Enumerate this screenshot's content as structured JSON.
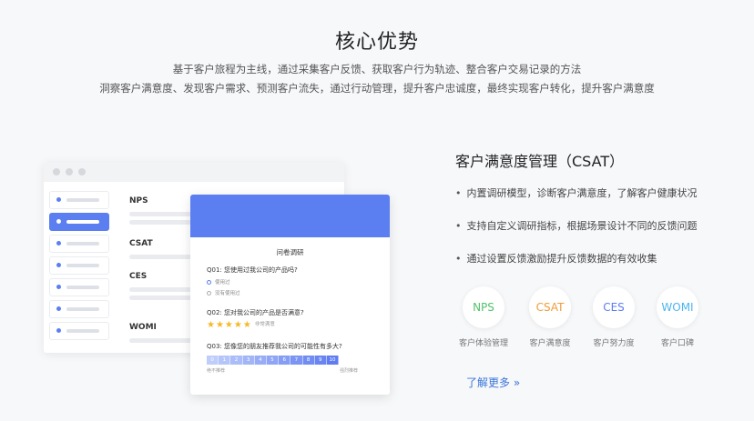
{
  "header": {
    "title": "核心优势",
    "subtitle_line1": "基于客户旅程为主线，通过采集客户反馈、获取客户行为轨迹、整合客户交易记录的方法",
    "subtitle_line2": "洞察客户满意度、发现客户需求、预测客户流失，通过行动管理，提升客户忠诚度，最终实现客户转化，提升客户满意度"
  },
  "mockup": {
    "metrics": [
      "NPS",
      "CSAT",
      "CES",
      "WOMI"
    ],
    "survey": {
      "title": "问卷调研",
      "q1": "Q01: 您使用过我公司的产品吗?",
      "q1_options": [
        "使用过",
        "没有使用过"
      ],
      "q2": "Q02: 您对我公司的产品是否满意?",
      "q2_hint": "非常满意",
      "q2_stars": 5,
      "q3": "Q03: 您像您的朋友推荐我公司的可能性有多大?",
      "scale": [
        "0",
        "1",
        "2",
        "3",
        "4",
        "5",
        "6",
        "7",
        "8",
        "9",
        "10"
      ],
      "scale_low": "绝不推荐",
      "scale_high": "强烈推荐"
    }
  },
  "feature": {
    "title": "客户满意度管理（CSAT）",
    "bullets": [
      "内置调研模型，诊断客户满意度，了解客户健康状况",
      "支持自定义调研指标，根据场景设计不同的反馈问题",
      "通过设置反馈激励提升反馈数据的有效收集"
    ],
    "badges": [
      {
        "abbr": "NPS",
        "label": "客户体验管理",
        "color": "#52c26b"
      },
      {
        "abbr": "CSAT",
        "label": "客户满意度",
        "color": "#f09c3a"
      },
      {
        "abbr": "CES",
        "label": "客户努力度",
        "color": "#5b7ef0"
      },
      {
        "abbr": "WOMI",
        "label": "客户口碑",
        "color": "#4db4f0"
      }
    ],
    "more_link": "了解更多 »"
  },
  "colors": {
    "accent": "#5b7ef0",
    "star": "#f5b828",
    "link": "#3a75d8"
  }
}
